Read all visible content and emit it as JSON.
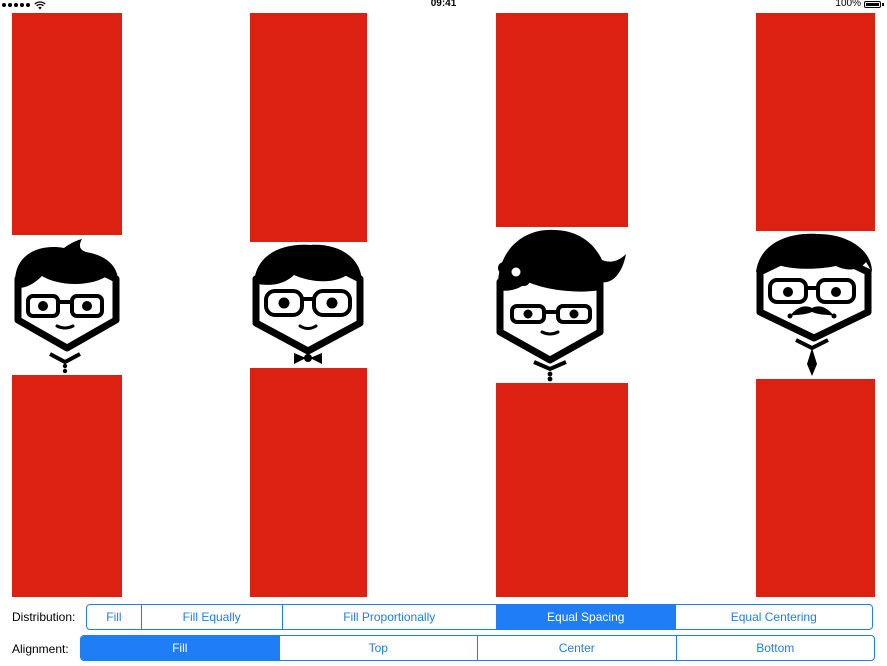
{
  "status_bar": {
    "time": "09:41",
    "battery": "100%"
  },
  "distribution": {
    "label": "Distribution:",
    "segments": [
      "Fill",
      "Fill Equally",
      "Fill Proportionally",
      "Equal Spacing",
      "Equal Centering"
    ],
    "selected": "Equal Spacing"
  },
  "alignment": {
    "label": "Alignment:",
    "segments": [
      "Fill",
      "Top",
      "Center",
      "Bottom"
    ],
    "selected": "Fill"
  },
  "colors": {
    "accent": "#1f7ef6",
    "block": "#dc2112"
  },
  "characters": [
    "boy-with-glasses",
    "boy-with-bowtie",
    "girl-with-flower",
    "man-with-mustache"
  ]
}
